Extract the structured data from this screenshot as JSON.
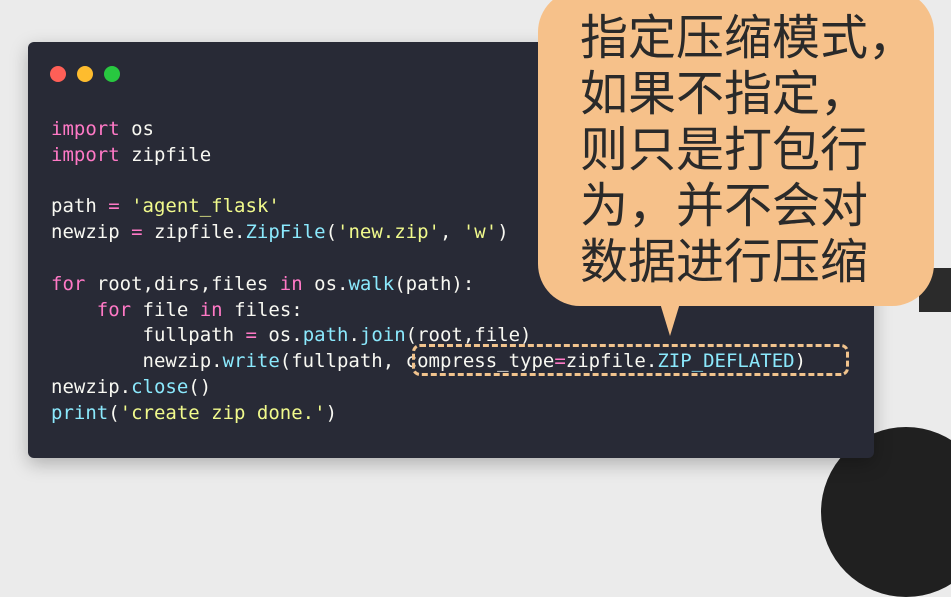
{
  "window": {
    "controls": [
      {
        "name": "close",
        "color": "#ff5f57"
      },
      {
        "name": "minimize",
        "color": "#febc2e"
      },
      {
        "name": "maximize",
        "color": "#28c840"
      }
    ]
  },
  "code_lines": [
    [
      {
        "t": "import",
        "c": "kw"
      },
      {
        "t": " os",
        "c": "pl"
      }
    ],
    [
      {
        "t": "import",
        "c": "kw"
      },
      {
        "t": " zipfile",
        "c": "pl"
      }
    ],
    [],
    [
      {
        "t": "path ",
        "c": "pl"
      },
      {
        "t": "=",
        "c": "kw"
      },
      {
        "t": " ",
        "c": "pl"
      },
      {
        "t": "'agent_flask'",
        "c": "st"
      }
    ],
    [
      {
        "t": "newzip ",
        "c": "pl"
      },
      {
        "t": "=",
        "c": "kw"
      },
      {
        "t": " zipfile.",
        "c": "pl"
      },
      {
        "t": "ZipFile",
        "c": "fn"
      },
      {
        "t": "(",
        "c": "pl"
      },
      {
        "t": "'new.zip'",
        "c": "st"
      },
      {
        "t": ", ",
        "c": "pl"
      },
      {
        "t": "'w'",
        "c": "st"
      },
      {
        "t": ")",
        "c": "pl"
      }
    ],
    [],
    [
      {
        "t": "for",
        "c": "kw"
      },
      {
        "t": " root,dirs,files ",
        "c": "pl"
      },
      {
        "t": "in",
        "c": "kw"
      },
      {
        "t": " os.",
        "c": "pl"
      },
      {
        "t": "walk",
        "c": "fn"
      },
      {
        "t": "(path):",
        "c": "pl"
      }
    ],
    [
      {
        "t": "    ",
        "c": "pl"
      },
      {
        "t": "for",
        "c": "kw"
      },
      {
        "t": " file ",
        "c": "pl"
      },
      {
        "t": "in",
        "c": "kw"
      },
      {
        "t": " files:",
        "c": "pl"
      }
    ],
    [
      {
        "t": "        fullpath ",
        "c": "pl"
      },
      {
        "t": "=",
        "c": "kw"
      },
      {
        "t": " os.",
        "c": "pl"
      },
      {
        "t": "path",
        "c": "fn"
      },
      {
        "t": ".",
        "c": "pl"
      },
      {
        "t": "join",
        "c": "fn"
      },
      {
        "t": "(root,file)",
        "c": "pl"
      }
    ],
    [
      {
        "t": "        newzip.",
        "c": "pl"
      },
      {
        "t": "write",
        "c": "fn"
      },
      {
        "t": "(fullpath, compress_type",
        "c": "pl"
      },
      {
        "t": "=",
        "c": "kw"
      },
      {
        "t": "zipfile.",
        "c": "pl"
      },
      {
        "t": "ZIP_DEFLATED",
        "c": "fn"
      },
      {
        "t": ")",
        "c": "pl"
      }
    ],
    [
      {
        "t": "newzip.",
        "c": "pl"
      },
      {
        "t": "close",
        "c": "fn"
      },
      {
        "t": "()",
        "c": "pl"
      }
    ],
    [
      {
        "t": "print",
        "c": "fn"
      },
      {
        "t": "(",
        "c": "pl"
      },
      {
        "t": "'create zip done.'",
        "c": "st"
      },
      {
        "t": ")",
        "c": "pl"
      }
    ]
  ],
  "callout": {
    "lines": [
      "指定压缩模式，",
      "如果不指定，",
      "则只是打包行",
      "为，并不会对",
      "数据进行压缩"
    ],
    "color": "#f6c18a"
  },
  "highlight_color": "#f1c38d"
}
